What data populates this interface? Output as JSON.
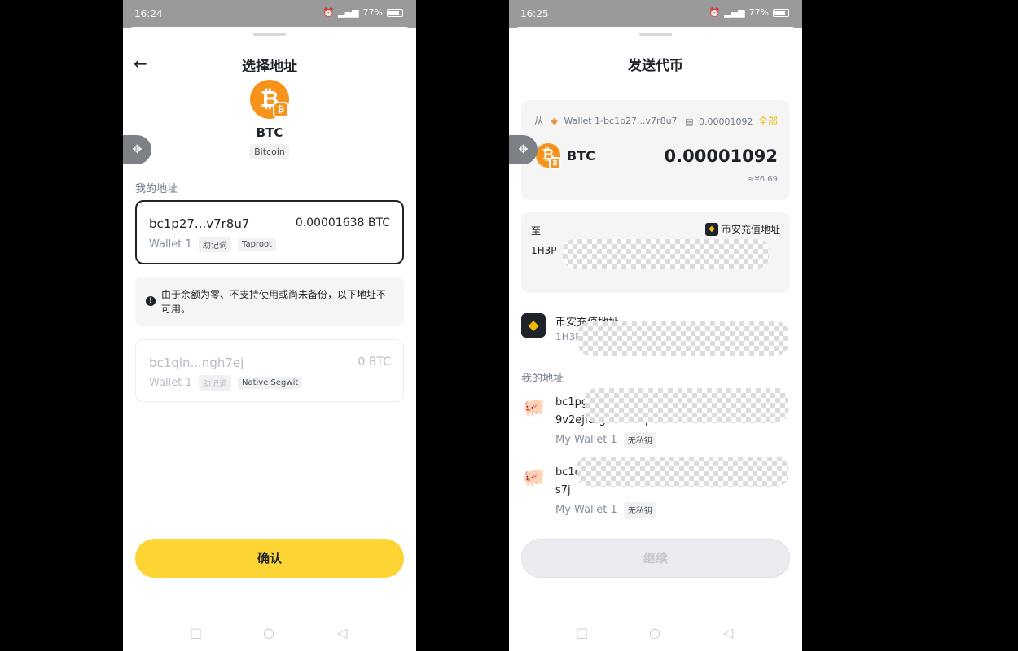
{
  "left": {
    "status": {
      "time": "16:24",
      "battery": "77%"
    },
    "title": "选择地址",
    "coin": {
      "symbol": "BTC",
      "name": "Bitcoin"
    },
    "section_label": "我的地址",
    "selected": {
      "address": "bc1p27...v7r8u7",
      "amount": "0.00001638 BTC",
      "wallet": "Wallet 1",
      "tag1": "助记词",
      "tag2": "Taproot"
    },
    "notice": "由于余额为零、不支持使用或尚未备份，以下地址不可用。",
    "disabled": {
      "address": "bc1qln...ngh7ej",
      "amount": "0 BTC",
      "wallet": "Wallet 1",
      "tag1": "助记词",
      "tag2": "Native Segwit"
    },
    "confirm_label": "确认",
    "colors": {
      "accent": "#fcd535",
      "bitcoin": "#f7931a"
    }
  },
  "right": {
    "status": {
      "time": "16:25",
      "battery": "77%"
    },
    "title": "发送代币",
    "from": {
      "label": "从",
      "wallet": "Wallet 1-bc1p27...v7r8u7",
      "balance": "0.00001092",
      "max_label": "全部"
    },
    "asset": {
      "symbol": "BTC",
      "amount": "0.00001092",
      "fiat": "≈¥6.69"
    },
    "to": {
      "label": "至",
      "badge": "币安充值地址",
      "address": "1H3P"
    },
    "suggest": {
      "name": "币安充值地址",
      "address": "1H3P"
    },
    "section_label": "我的地址",
    "addr1": {
      "line1": "bc1pgg",
      "line2": "9v2ejfarga3sr2zqmfskn0nv0",
      "wallet": "My Wallet 1",
      "tag": "无私钥"
    },
    "addr2": {
      "line1": "bc1q",
      "line2": "s7j",
      "wallet": "My Wallet 1",
      "tag": "无私钥"
    },
    "continue_label": "继续"
  }
}
